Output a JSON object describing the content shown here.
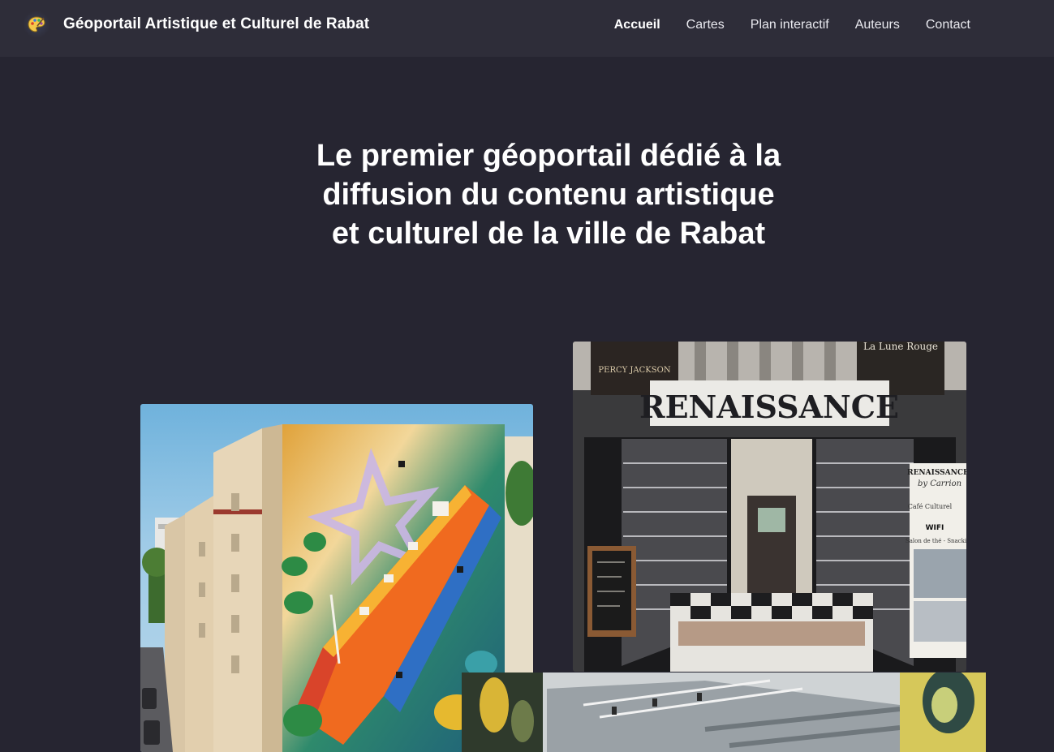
{
  "nav": {
    "brand": "Géoportail Artistique et Culturel de Rabat",
    "logo_icon": "palette-icon",
    "links": [
      {
        "label": "Accueil",
        "active": true
      },
      {
        "label": "Cartes",
        "active": false
      },
      {
        "label": "Plan interactif",
        "active": false
      },
      {
        "label": "Auteurs",
        "active": false
      },
      {
        "label": "Contact",
        "active": false
      }
    ]
  },
  "hero": {
    "lines": [
      "Le premier géoportail dédié à la",
      "diffusion du contenu artistique",
      "et culturel de la ville de Rabat"
    ]
  },
  "photos": {
    "mural": {
      "alt": "street-art mural"
    },
    "cinema": {
      "sign": "RENAISSANCE",
      "poster_left": "PERCY JACKSON",
      "poster_right": "La Lune Rouge",
      "board_title": "RENAISSANCE",
      "board_subtitle": "by Carrion",
      "board_line1": "Café Culturel",
      "board_line2": "WIFI",
      "board_line3": "Salon de thé - Snacking"
    },
    "gallery": {
      "alt": "gallery interior"
    }
  },
  "colors": {
    "background": "#262531",
    "navbar": "#2e2d39",
    "text": "#ffffff"
  }
}
